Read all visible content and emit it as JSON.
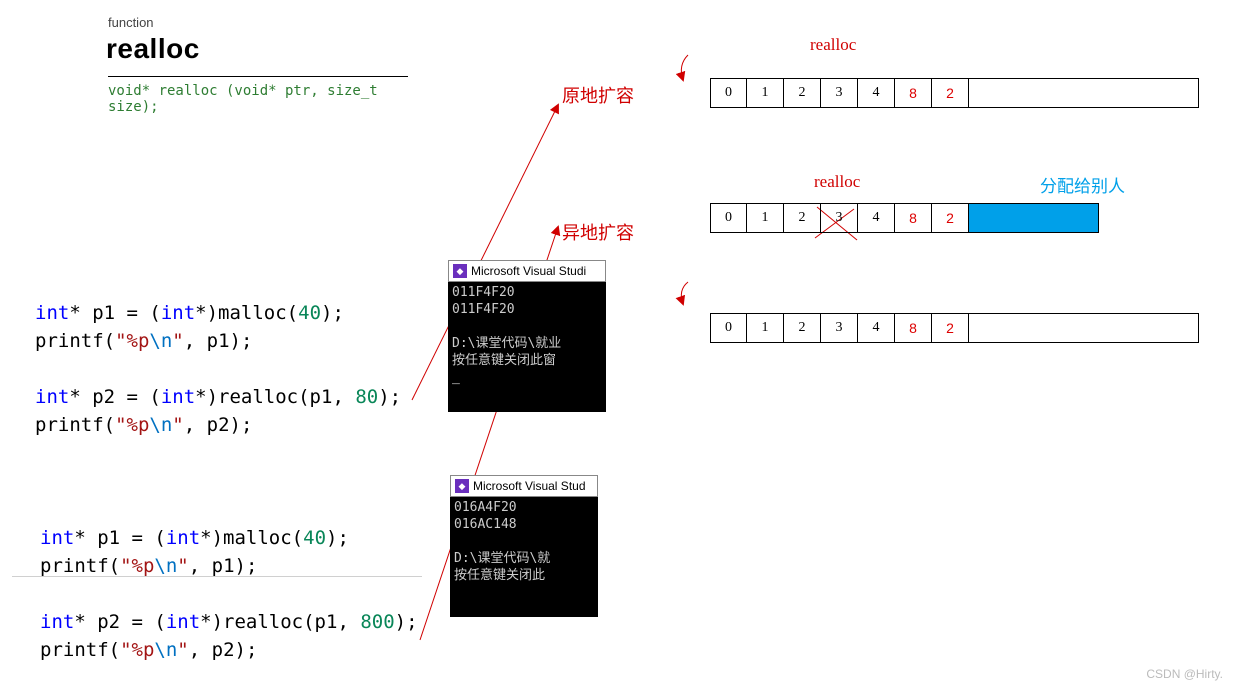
{
  "header": {
    "label": "function",
    "name": "realloc",
    "sig": "void* realloc (void* ptr, size_t size);"
  },
  "labels": {
    "inplace": "原地扩容",
    "relocate": "异地扩容",
    "realloc1": "realloc",
    "realloc2": "realloc",
    "given_away": "分配给别人"
  },
  "code1": {
    "l1_a": "int",
    "l1_b": "* p1 = (",
    "l1_c": "int",
    "l1_d": "*)malloc(",
    "l1_e": "40",
    "l1_f": ");",
    "l2_a": "printf(",
    "l2_b": "\"%p",
    "l2_c": "\\n",
    "l2_d": "\"",
    "l2_e": ", p1);",
    "l3_a": "int",
    "l3_b": "* p2 = (",
    "l3_c": "int",
    "l3_d": "*)realloc(p1, ",
    "l3_e": "80",
    "l3_f": ");",
    "l4_a": "printf(",
    "l4_b": "\"%p",
    "l4_c": "\\n",
    "l4_d": "\"",
    "l4_e": ", p2);"
  },
  "code2": {
    "l1_a": "int",
    "l1_b": "* p1 = (",
    "l1_c": "int",
    "l1_d": "*)malloc(",
    "l1_e": "40",
    "l1_f": ");",
    "l2_a": "printf(",
    "l2_b": "\"%p",
    "l2_c": "\\n",
    "l2_d": "\"",
    "l2_e": ", p1);",
    "l3_a": "int",
    "l3_b": "* p2 = (",
    "l3_c": "int",
    "l3_d": "*)realloc(p1, ",
    "l3_e": "800",
    "l3_f": ");",
    "l4_a": "printf(",
    "l4_b": "\"%p",
    "l4_c": "\\n",
    "l4_d": "\"",
    "l4_e": ", p2);"
  },
  "console1": {
    "title": "Microsoft Visual Studi",
    "l1": "011F4F20",
    "l2": "011F4F20",
    "l3": "D:\\课堂代码\\就业",
    "l4": "按任意键关闭此窗"
  },
  "console2": {
    "title": "Microsoft Visual Stud",
    "l1": "016A4F20",
    "l2": "016AC148",
    "l3": "D:\\课堂代码\\就",
    "l4": "按任意键关闭此"
  },
  "mem": {
    "row1": [
      "0",
      "1",
      "2",
      "3",
      "4",
      "8",
      "2"
    ],
    "row2": [
      "0",
      "1",
      "2",
      "3",
      "4",
      "8",
      "2"
    ],
    "row3": [
      "0",
      "1",
      "2",
      "3",
      "4",
      "8",
      "2"
    ]
  },
  "watermark": "CSDN @Hirty."
}
